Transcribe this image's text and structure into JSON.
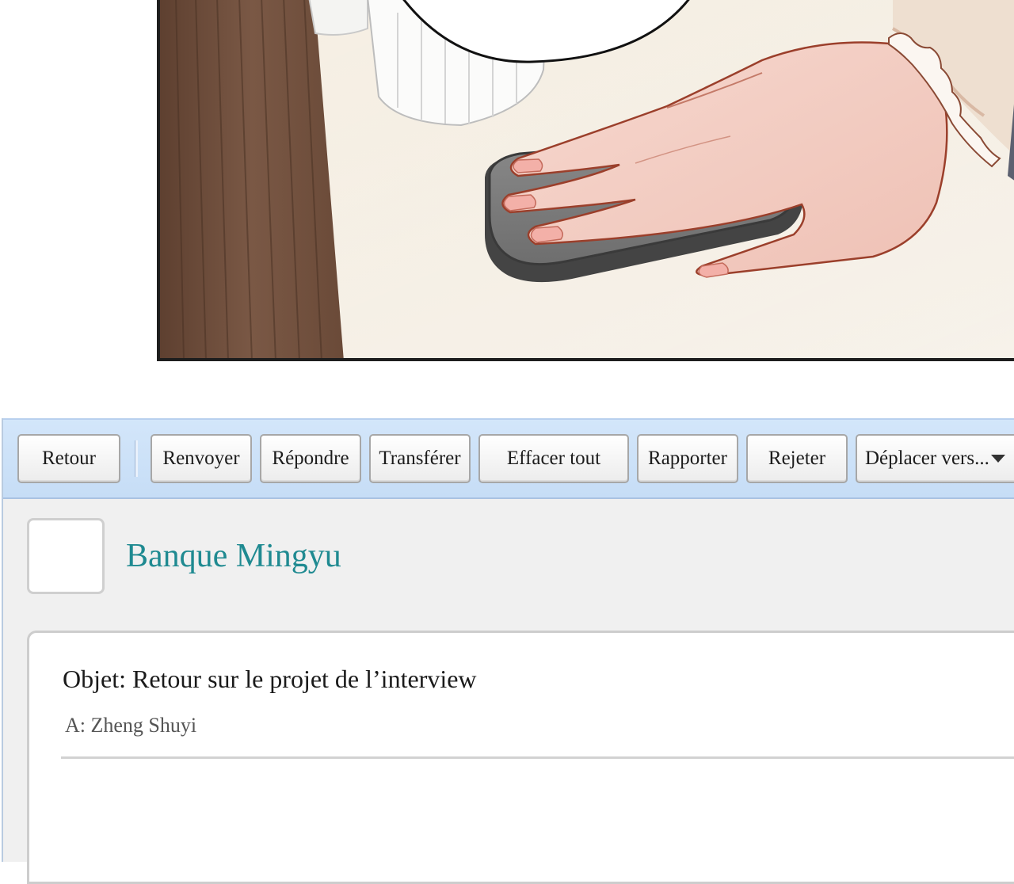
{
  "illustration": {
    "description_icon": "hand-on-mouse-illustration"
  },
  "toolbar": {
    "buttons": [
      {
        "label": "Retour"
      },
      {
        "label": "Renvoyer"
      },
      {
        "label": "Répondre"
      },
      {
        "label": "Transférer"
      },
      {
        "label": "Effacer tout"
      },
      {
        "label": "Rapporter"
      },
      {
        "label": "Rejeter"
      },
      {
        "label": "Déplacer vers..."
      }
    ]
  },
  "message": {
    "sender": "Banque Mingyu",
    "subject": "Objet: Retour sur le projet de l’interview",
    "recipient": "A: Zheng Shuyi"
  },
  "colors": {
    "toolbar_bg": "#c9dff7",
    "sender_name": "#1f8a91",
    "panel_border": "#1e1e1e"
  }
}
